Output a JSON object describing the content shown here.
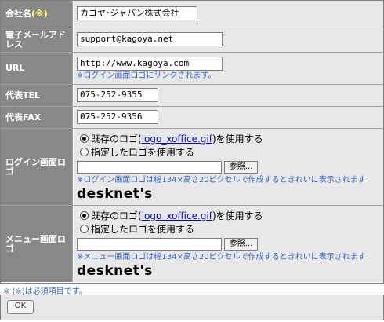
{
  "fields": {
    "company": {
      "label": "会社名",
      "required_mark": "(※)",
      "value": "カゴヤ･ジャパン株式会社"
    },
    "email": {
      "label": "電子メールアドレス",
      "value": "support@kagoya.net"
    },
    "url": {
      "label": "URL",
      "value": "http://www.kagoya.com",
      "note": "※ログイン画面ロゴにリンクされます。"
    },
    "tel": {
      "label": "代表TEL",
      "value": "075-252-9355"
    },
    "fax": {
      "label": "代表FAX",
      "value": "075-252-9356"
    },
    "login_logo": {
      "label": "ログイン画面ロゴ",
      "option_existing_prefix": "既存のロゴ(",
      "option_existing_file": "logo_xoffice.gif",
      "option_existing_suffix": ")を使用する",
      "option_custom": "指定したロゴを使用する",
      "file_value": "",
      "browse_label": "参照...",
      "note": "※ログイン画面ロゴは幅134×高さ20ピクセルで作成するときれいに表示されます",
      "logo_text": "desknet's"
    },
    "menu_logo": {
      "label": "メニュー画面ロゴ",
      "option_existing_prefix": "既存のロゴ(",
      "option_existing_file": "logo_xoffice.gif",
      "option_existing_suffix": ")を使用する",
      "option_custom": "指定したロゴを使用する",
      "file_value": "",
      "browse_label": "参照...",
      "note": "※メニュー画面ロゴは幅134×高さ20ピクセルで作成するときれいに表示されます",
      "logo_text": "desknet's"
    }
  },
  "footer_note": "※ (※)は必須項目です。",
  "ok_label": "OK",
  "colors": {
    "label_bg": "#888888",
    "value_bg": "#e8e8e8",
    "note": "#3366cc",
    "required": "#ffff66"
  }
}
